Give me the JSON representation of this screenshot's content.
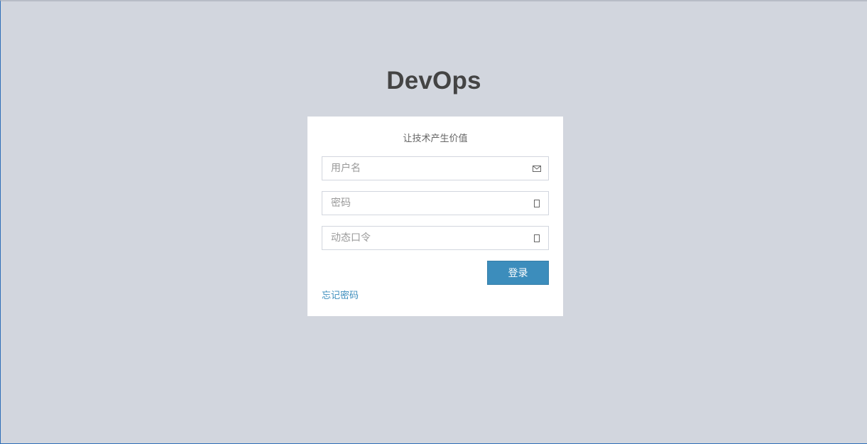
{
  "logo": {
    "title": "DevOps"
  },
  "login_box": {
    "message": "让技术产生价值",
    "username": {
      "placeholder": "用户名",
      "value": "",
      "icon": "envelope-icon"
    },
    "password": {
      "placeholder": "密码",
      "value": "",
      "icon": "lock-icon"
    },
    "otp": {
      "placeholder": "动态口令",
      "value": "",
      "icon": "mobile-phone-icon"
    },
    "submit_label": "登录",
    "forgot_label": "忘记密码"
  },
  "colors": {
    "background": "#d2d6de",
    "primary": "#3c8dbc",
    "title": "#444444"
  }
}
